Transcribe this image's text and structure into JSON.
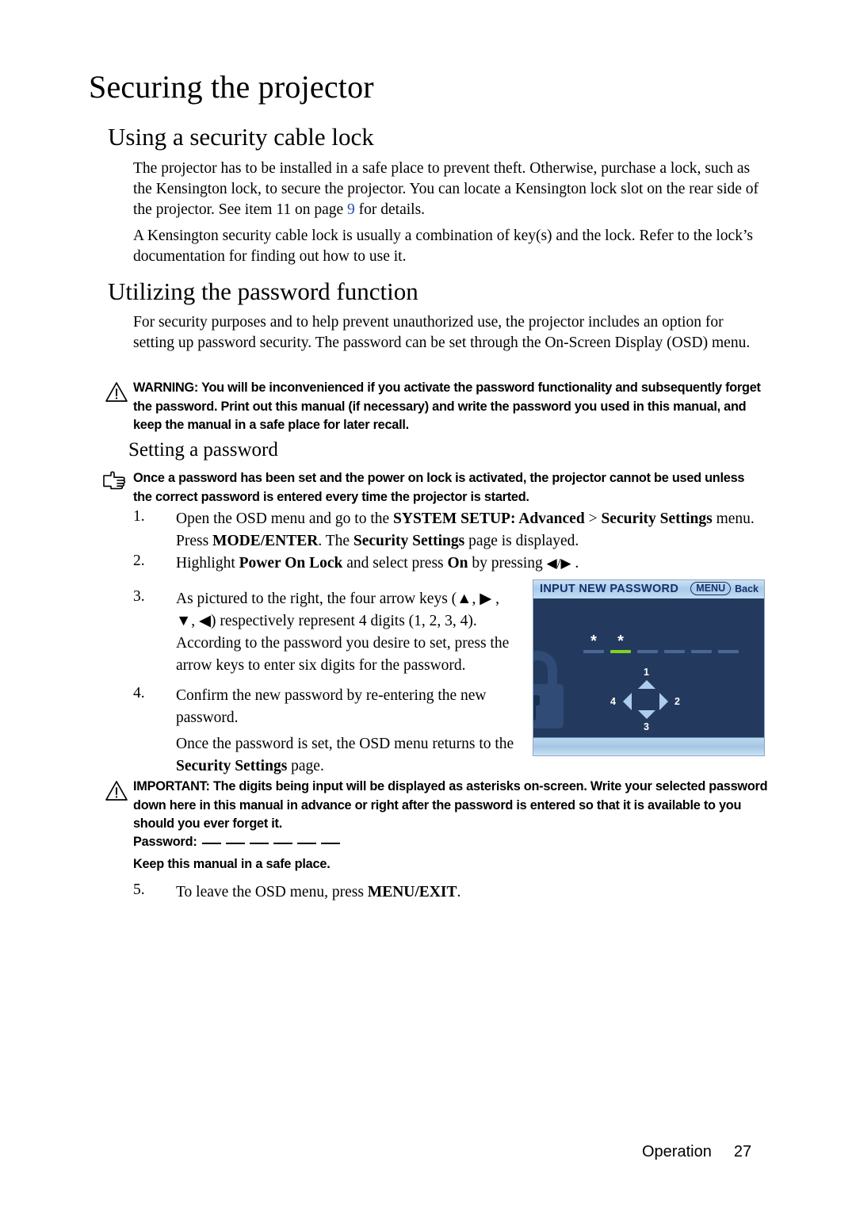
{
  "document": {
    "chapter_title": "Securing the projector",
    "footer": {
      "section": "Operation",
      "page_number": "27"
    }
  },
  "sections": {
    "cable_lock": {
      "heading": "Using a security cable lock",
      "paragraph_1_before_link": "The projector has to be installed in a safe place to prevent theft. Otherwise, purchase a lock, such as the Kensington lock, to secure the projector. You can locate a Kensington lock slot on the rear side of the projector. See item 11 on page ",
      "paragraph_1_link": "9",
      "paragraph_1_after_link": " for details.",
      "paragraph_2": "A Kensington security cable lock is usually a combination of key(s) and the lock. Refer to the lock’s documentation for finding out how to use it."
    },
    "password_function": {
      "heading": "Utilizing the password function",
      "paragraph": "For security purposes and to help prevent unauthorized use, the projector includes an option for setting up password security. The password can be set through the On-Screen Display (OSD) menu.",
      "warning": "WARNING: You will be inconvenienced if you activate the password functionality and subsequently forget the password. Print out this manual (if necessary) and write the password you used in this manual, and keep the manual in a safe place for later recall."
    },
    "setting_password": {
      "heading": "Setting a password",
      "tip": "Once a password has been set and the power on lock is activated, the projector cannot be used unless the correct password is entered every time the projector is started.",
      "steps": [
        {
          "number": "1.",
          "parts": [
            {
              "text": "Open the OSD menu and go to the ",
              "bold": false
            },
            {
              "text": "SYSTEM SETUP: Advanced",
              "bold": true
            },
            {
              "text": " > ",
              "bold": false
            },
            {
              "text": "Security Settings",
              "bold": true
            },
            {
              "text": " menu. Press ",
              "bold": false
            },
            {
              "text": "MODE/ENTER",
              "bold": true
            },
            {
              "text": ". The ",
              "bold": false
            },
            {
              "text": "Security Settings",
              "bold": true
            },
            {
              "text": " page is displayed.",
              "bold": false
            }
          ]
        },
        {
          "number": "2.",
          "parts": [
            {
              "text": "Highlight ",
              "bold": false
            },
            {
              "text": "Power On Lock",
              "bold": true
            },
            {
              "text": " and select press ",
              "bold": false
            },
            {
              "text": "On",
              "bold": true
            },
            {
              "text": " by pressing ",
              "bold": false
            },
            {
              "text": "◀/▶",
              "bold": false
            },
            {
              "text": " .",
              "bold": false
            }
          ]
        },
        {
          "number": "3.",
          "parts": [
            {
              "text": "As pictured to the right, the four arrow keys (▲, ▶ , ▼, ◀) respectively represent 4 digits (1, 2, 3, 4). According to the password you desire to set, press the arrow keys to enter six digits for the password.",
              "bold": false
            }
          ]
        },
        {
          "number": "4.",
          "parts": [
            {
              "text": "Confirm the new password by re-entering the new password.",
              "bold": false
            }
          ]
        }
      ],
      "step4_followup": [
        {
          "text": "Once the password is set, the OSD menu returns to the ",
          "bold": false
        },
        {
          "text": "Security Settings",
          "bold": true
        },
        {
          "text": " page.",
          "bold": false
        }
      ],
      "important": "IMPORTANT: The digits being input will be displayed as asterisks on-screen. Write your selected password down here in this manual in advance or right after the password is entered so that it is available to you should you ever forget it.",
      "password_label": "Password:",
      "password_blank_count": 6,
      "keep_manual_note": "Keep this manual in a safe place.",
      "step5": {
        "number": "5.",
        "parts": [
          {
            "text": "To leave the OSD menu, press ",
            "bold": false
          },
          {
            "text": "MENU/EXIT",
            "bold": true
          },
          {
            "text": ".",
            "bold": false
          }
        ]
      }
    }
  },
  "osd_screenshot": {
    "title": "INPUT NEW PASSWORD",
    "password_slots": [
      {
        "char": "*",
        "filled": true,
        "active": false
      },
      {
        "char": "*",
        "filled": true,
        "active": true
      },
      {
        "char": "",
        "filled": false,
        "active": false
      },
      {
        "char": "",
        "filled": false,
        "active": false
      },
      {
        "char": "",
        "filled": false,
        "active": false
      },
      {
        "char": "",
        "filled": false,
        "active": false
      }
    ],
    "keypad": {
      "up_label": "1",
      "right_label": "2",
      "down_label": "3",
      "left_label": "4"
    },
    "footer": {
      "key": "MENU",
      "action": "Back"
    },
    "colors": {
      "body_bg": "#24395e",
      "titlebar": "#a9cbe9",
      "title_text": "#16306b",
      "active_dash": "#7ed321",
      "inactive_dash": "#4a6896",
      "arrow": "#aecdec",
      "watermark": "#2f4b76"
    }
  }
}
